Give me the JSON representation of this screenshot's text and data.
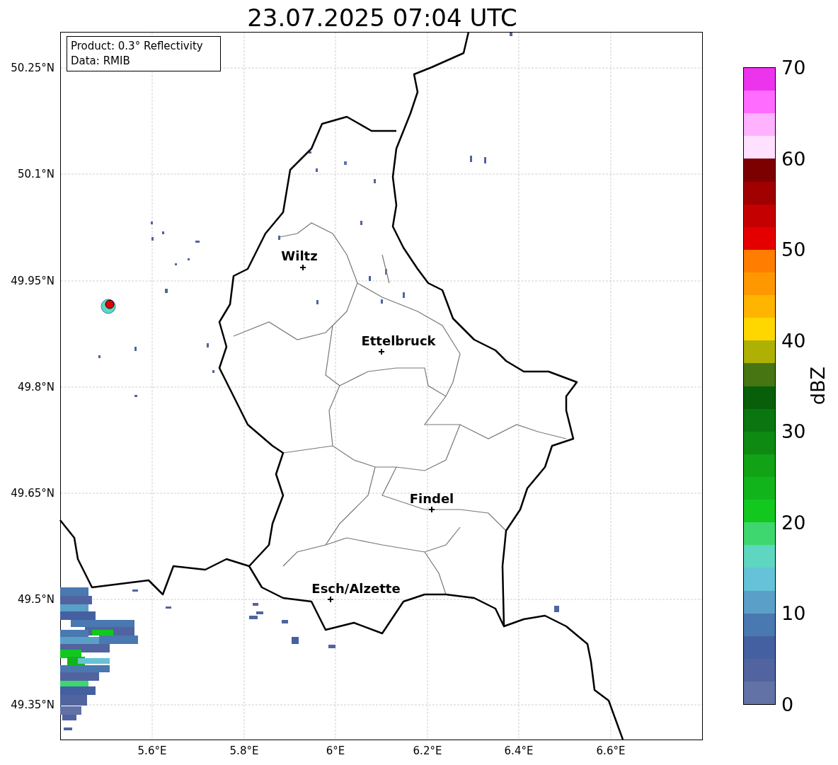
{
  "title": "23.07.2025 07:04 UTC",
  "info_box": [
    "Product: 0.3° Reflectivity",
    "Data: RMIB"
  ],
  "lat_labels": [
    "50.25°N",
    "50.1°N",
    "49.95°N",
    "49.8°N",
    "49.65°N",
    "49.5°N",
    "49.35°N"
  ],
  "lon_labels": [
    "5.6°E",
    "5.8°E",
    "6°E",
    "6.2°E",
    "6.4°E",
    "6.6°E"
  ],
  "cities": [
    {
      "name": "Wiltz"
    },
    {
      "name": "Ettelbruck"
    },
    {
      "name": "Findel"
    },
    {
      "name": "Esch/Alzette"
    }
  ],
  "colorbar": {
    "label": "dBZ",
    "ticks": [
      "70",
      "60",
      "50",
      "40",
      "30",
      "20",
      "10",
      "0"
    ],
    "bins": [
      {
        "color": "#ec34ec"
      },
      {
        "color": "#ff6cff"
      },
      {
        "color": "#ffb2ff"
      },
      {
        "color": "#ffe0ff"
      },
      {
        "color": "#7c0000"
      },
      {
        "color": "#a00000"
      },
      {
        "color": "#c40000"
      },
      {
        "color": "#e40000"
      },
      {
        "color": "#ff7d00"
      },
      {
        "color": "#ff9800"
      },
      {
        "color": "#ffb400"
      },
      {
        "color": "#ffd700"
      },
      {
        "color": "#aeb004"
      },
      {
        "color": "#477512"
      },
      {
        "color": "#075f0a"
      },
      {
        "color": "#0a760f"
      },
      {
        "color": "#0e8a12"
      },
      {
        "color": "#11a216"
      },
      {
        "color": "#12b41b"
      },
      {
        "color": "#12c81e"
      },
      {
        "color": "#3ed66e"
      },
      {
        "color": "#5fd6c0"
      },
      {
        "color": "#65c2d8"
      },
      {
        "color": "#5a9fc8"
      },
      {
        "color": "#4a78b0"
      },
      {
        "color": "#4560a0"
      },
      {
        "color": "#51649f"
      },
      {
        "color": "#6272a6"
      }
    ]
  }
}
